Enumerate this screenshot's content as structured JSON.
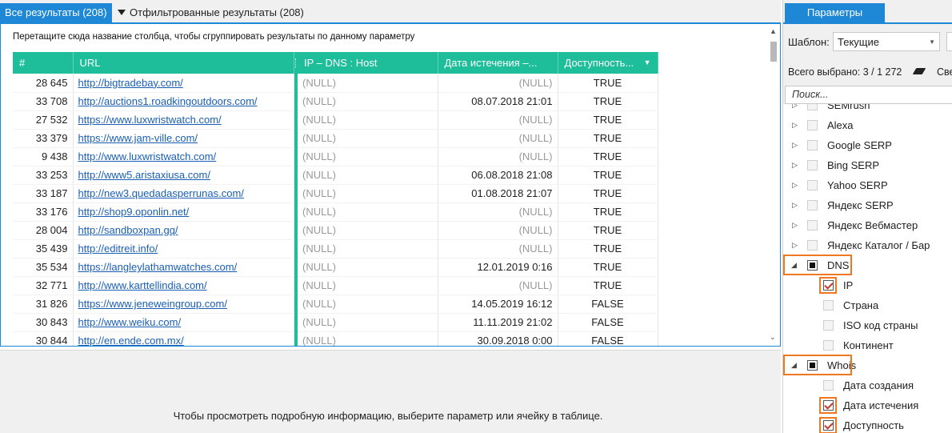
{
  "tabs": {
    "all": "Все результаты (208)",
    "filtered": "Отфильтрованные результаты (208)"
  },
  "group_hint": "Перетащите сюда название столбца, чтобы сгруппировать результаты по данному параметру",
  "columns": {
    "num": "#",
    "url": "URL",
    "ip": "IP – DNS : Host",
    "expiry": "Дата истечения –...",
    "avail": "Доступность..."
  },
  "rows": [
    {
      "num": "28 645",
      "url": "http://bigtradebay.com/",
      "ip": "(NULL)",
      "expiry": "(NULL)",
      "avail": "TRUE"
    },
    {
      "num": "33 708",
      "url": "http://auctions1.roadkingoutdoors.com/",
      "ip": "(NULL)",
      "expiry": "08.07.2018 21:01",
      "avail": "TRUE"
    },
    {
      "num": "27 532",
      "url": "https://www.luxwristwatch.com/",
      "ip": "(NULL)",
      "expiry": "(NULL)",
      "avail": "TRUE"
    },
    {
      "num": "33 379",
      "url": "https://www.jam-ville.com/",
      "ip": "(NULL)",
      "expiry": "(NULL)",
      "avail": "TRUE"
    },
    {
      "num": "9 438",
      "url": "http://www.luxwristwatch.com/",
      "ip": "(NULL)",
      "expiry": "(NULL)",
      "avail": "TRUE"
    },
    {
      "num": "33 253",
      "url": "http://www5.aristaxiusa.com/",
      "ip": "(NULL)",
      "expiry": "06.08.2018 21:08",
      "avail": "TRUE"
    },
    {
      "num": "33 187",
      "url": "http://new3.quedadasperrunas.com/",
      "ip": "(NULL)",
      "expiry": "01.08.2018 21:07",
      "avail": "TRUE"
    },
    {
      "num": "33 176",
      "url": "http://shop9.oponlin.net/",
      "ip": "(NULL)",
      "expiry": "(NULL)",
      "avail": "TRUE"
    },
    {
      "num": "28 004",
      "url": "http://sandboxpan.gq/",
      "ip": "(NULL)",
      "expiry": "(NULL)",
      "avail": "TRUE"
    },
    {
      "num": "35 439",
      "url": "http://editreit.info/",
      "ip": "(NULL)",
      "expiry": "(NULL)",
      "avail": "TRUE"
    },
    {
      "num": "35 534",
      "url": "https://langleylathamwatches.com/",
      "ip": "(NULL)",
      "expiry": "12.01.2019 0:16",
      "avail": "TRUE"
    },
    {
      "num": "32 771",
      "url": "http://www.karttellindia.com/",
      "ip": "(NULL)",
      "expiry": "(NULL)",
      "avail": "TRUE"
    },
    {
      "num": "31 826",
      "url": "https://www.jeneweingroup.com/",
      "ip": "(NULL)",
      "expiry": "14.05.2019 16:12",
      "avail": "FALSE"
    },
    {
      "num": "30 843",
      "url": "http://www.weiku.com/",
      "ip": "(NULL)",
      "expiry": "11.11.2019 21:02",
      "avail": "FALSE"
    },
    {
      "num": "30 844",
      "url": "http://en.ende.com.mx/",
      "ip": "(NULL)",
      "expiry": "30.09.2018 0:00",
      "avail": "FALSE"
    }
  ],
  "detail_text": "Чтобы просмотреть подробную информацию, выберите параметр или ячейку в таблице.",
  "panel": {
    "tab": "Параметры",
    "template_label": "Шаблон:",
    "template_value": "Текущие",
    "selected_count": "Всего выбрано: 3 / 1 272",
    "selected_more": "Све",
    "search_placeholder": "Поиск...",
    "tree": [
      {
        "label": "SEMrush",
        "level": 0,
        "state": "unchecked"
      },
      {
        "label": "Alexa",
        "level": 0,
        "state": "unchecked"
      },
      {
        "label": "Google SERP",
        "level": 0,
        "state": "unchecked"
      },
      {
        "label": "Bing SERP",
        "level": 0,
        "state": "unchecked"
      },
      {
        "label": "Yahoo SERP",
        "level": 0,
        "state": "unchecked"
      },
      {
        "label": "Яндекс SERP",
        "level": 0,
        "state": "unchecked"
      },
      {
        "label": "Яндекс Вебмастер",
        "level": 0,
        "state": "unchecked"
      },
      {
        "label": "Яндекс Каталог / Бар",
        "level": 0,
        "state": "unchecked"
      },
      {
        "label": "DNS",
        "level": 0,
        "state": "partial"
      },
      {
        "label": "IP",
        "level": 1,
        "state": "checked"
      },
      {
        "label": "Страна",
        "level": 1,
        "state": "unchecked"
      },
      {
        "label": "ISO код страны",
        "level": 1,
        "state": "unchecked"
      },
      {
        "label": "Континент",
        "level": 1,
        "state": "unchecked"
      },
      {
        "label": "Whois",
        "level": 0,
        "state": "partial"
      },
      {
        "label": "Дата создания",
        "level": 1,
        "state": "unchecked"
      },
      {
        "label": "Дата истечения",
        "level": 1,
        "state": "checked"
      },
      {
        "label": "Доступность",
        "level": 1,
        "state": "checked"
      }
    ]
  },
  "colors": {
    "accent": "#1e88d6",
    "header": "#1fbe9b",
    "highlight": "#f07820",
    "link": "#1a5fb4"
  }
}
